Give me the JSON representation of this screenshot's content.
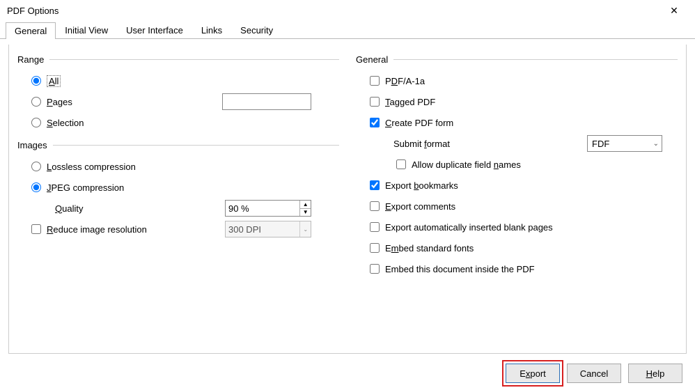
{
  "window": {
    "title": "PDF Options"
  },
  "tabs": {
    "general": "General",
    "initial_view": "Initial View",
    "user_interface": "User Interface",
    "links": "Links",
    "security": "Security"
  },
  "range": {
    "title": "Range",
    "all_html": "<span class=\"dotted\"><span class=\"ulchar\">A</span>ll</span>",
    "pages_html": "<span class=\"ulchar\">P</span>ages",
    "selection_html": "<span class=\"ulchar\">S</span>election",
    "pages_value": ""
  },
  "images": {
    "title": "Images",
    "lossless_html": "<span class=\"ulchar\">L</span>ossless compression",
    "jpeg_html": "<span class=\"ulchar\">J</span>PEG compression",
    "quality_html": "<span class=\"ulchar\">Q</span>uality",
    "quality_value": "90 %",
    "reduce_html": "<span class=\"ulchar\">R</span>educe image resolution",
    "resolution_value": "300 DPI"
  },
  "general": {
    "title": "General",
    "pdfa_html": "P<span class=\"ulchar\">D</span>F/A-1a",
    "tagged_html": "<span class=\"ulchar\">T</span>agged PDF",
    "create_form_html": "<span class=\"ulchar\">C</span>reate PDF form",
    "submit_format_html": "Submit <span class=\"ulchar\">f</span>ormat",
    "submit_value": "FDF",
    "allow_dup_html": "Allow duplicate field <span class=\"ulchar\">n</span>ames",
    "bookmarks_html": "Export <span class=\"ulchar\">b</span>ookmarks",
    "comments_html": "<span class=\"ulchar\">E</span>xport comments",
    "blank_html": "Export automatically inserted blank pa<span class=\"ulchar\">g</span>es",
    "embed_std_html": "E<span class=\"ulchar\">m</span>bed standard fonts",
    "embed_doc_html": "Embed this document inside the PDF"
  },
  "buttons": {
    "export_html": "E<span class=\"ulchar\">x</span>port",
    "cancel": "Cancel",
    "help_html": "<span class=\"ulchar\">H</span>elp"
  }
}
